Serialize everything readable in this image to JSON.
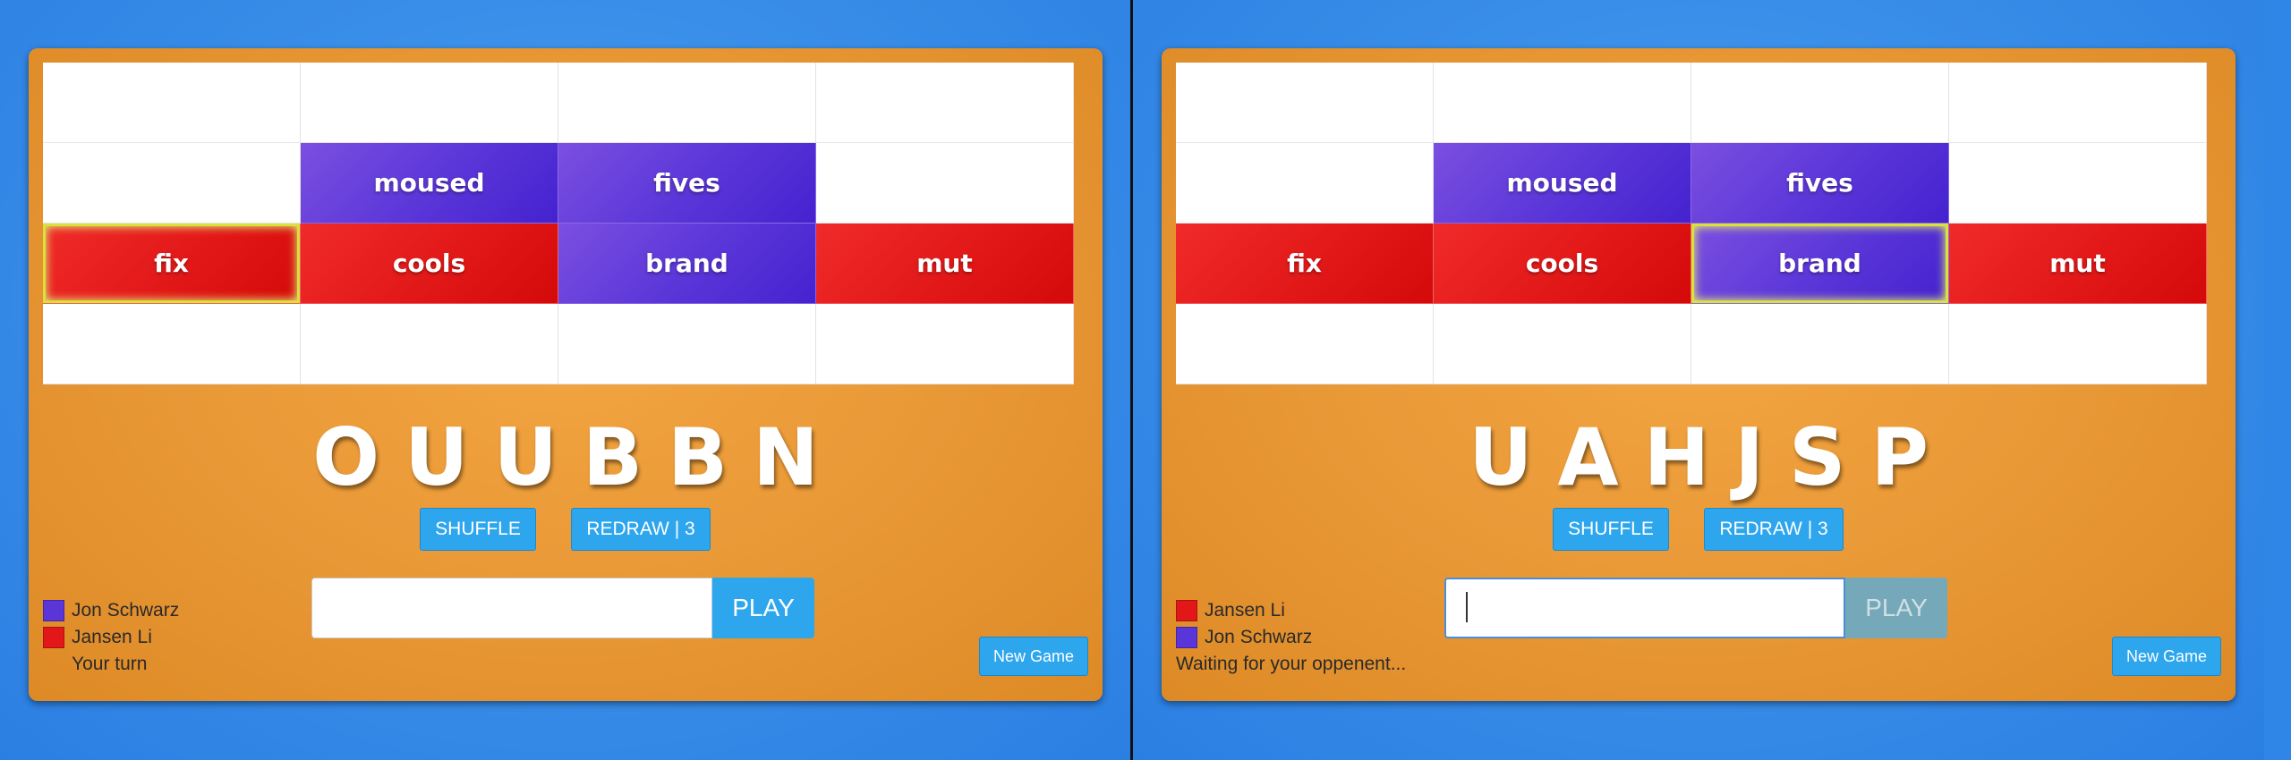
{
  "colors": {
    "player_purple": "#5a35d8",
    "player_red": "#e21818",
    "board_orange": "#e89735",
    "button_blue": "#2ea6ee"
  },
  "views": [
    {
      "board": [
        [
          "",
          "",
          "",
          ""
        ],
        [
          "",
          "moused",
          "fives",
          ""
        ],
        [
          "fix",
          "cools",
          "brand",
          "mut"
        ],
        [
          "",
          "",
          "",
          ""
        ]
      ],
      "tile_colors": [
        [
          "",
          "",
          "",
          ""
        ],
        [
          "",
          "purple",
          "purple",
          ""
        ],
        [
          "red",
          "red",
          "purple",
          "red"
        ],
        [
          "",
          "",
          "",
          ""
        ]
      ],
      "selected": [
        2,
        0
      ],
      "letters": [
        "O",
        "U",
        "U",
        "B",
        "B",
        "N"
      ],
      "shuffle_label": "SHUFFLE",
      "redraw_label": "REDRAW | 3",
      "word_input": {
        "value": "",
        "placeholder": ""
      },
      "play_label": "PLAY",
      "play_enabled": true,
      "players": [
        {
          "name": "Jon Schwarz",
          "color": "purple"
        },
        {
          "name": "Jansen Li",
          "color": "red"
        }
      ],
      "status": "Your turn",
      "new_game_label": "New Game"
    },
    {
      "board": [
        [
          "",
          "",
          "",
          ""
        ],
        [
          "",
          "moused",
          "fives",
          ""
        ],
        [
          "fix",
          "cools",
          "brand",
          "mut"
        ],
        [
          "",
          "",
          "",
          ""
        ]
      ],
      "tile_colors": [
        [
          "",
          "",
          "",
          ""
        ],
        [
          "",
          "purple",
          "purple",
          ""
        ],
        [
          "red",
          "red",
          "purple",
          "red"
        ],
        [
          "",
          "",
          "",
          ""
        ]
      ],
      "selected": [
        2,
        2
      ],
      "letters": [
        "U",
        "A",
        "H",
        "J",
        "S",
        "P"
      ],
      "shuffle_label": "SHUFFLE",
      "redraw_label": "REDRAW | 3",
      "word_input": {
        "value": "",
        "placeholder": ""
      },
      "play_label": "PLAY",
      "play_enabled": false,
      "players": [
        {
          "name": "Jansen Li",
          "color": "red"
        },
        {
          "name": "Jon Schwarz",
          "color": "purple"
        }
      ],
      "status": "Waiting for your oppenent...",
      "new_game_label": "New Game"
    }
  ]
}
